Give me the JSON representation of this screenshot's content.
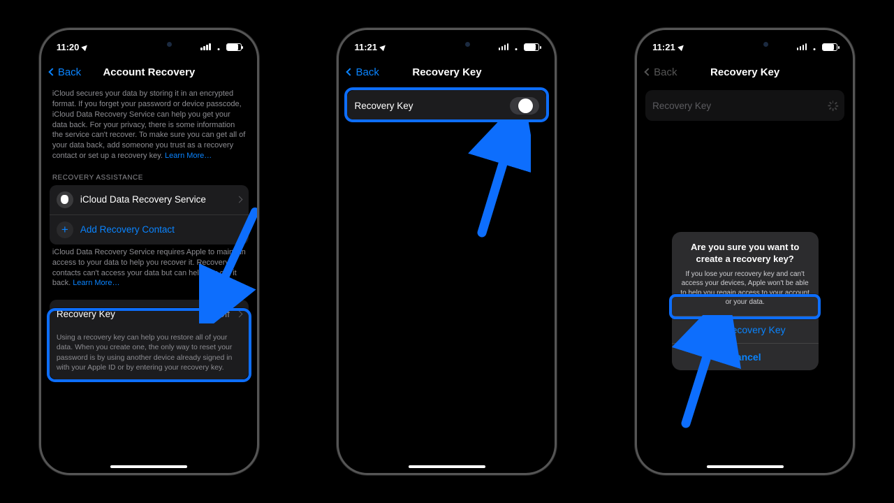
{
  "phone1": {
    "time": "11:20",
    "back": "Back",
    "title": "Account Recovery",
    "intro": "iCloud secures your data by storing it in an encrypted format. If you forget your password or device passcode, iCloud Data Recovery Service can help you get your data back. For your privacy, there is some information the service can't recover. To make sure you can get all of your data back, add someone you trust as a recovery contact or set up a recovery key.",
    "learn_more": "Learn More…",
    "section_label": "RECOVERY ASSISTANCE",
    "row_icloud": "iCloud Data Recovery Service",
    "row_add_contact": "Add Recovery Contact",
    "assist_desc": "iCloud Data Recovery Service requires Apple to maintain access to your data to help you recover it. Recovery contacts can't access your data but can help you get it back.",
    "assist_learn": "Learn More…",
    "recovery_key_label": "Recovery Key",
    "recovery_key_value": "Off",
    "recovery_desc": "Using a recovery key can help you restore all of your data. When you create one, the only way to reset your password is by using another device already signed in with your Apple ID or by entering your recovery key."
  },
  "phone2": {
    "time": "11:21",
    "back": "Back",
    "title": "Recovery Key",
    "toggle_label": "Recovery Key"
  },
  "phone3": {
    "time": "11:21",
    "back": "Back",
    "title": "Recovery Key",
    "row_label": "Recovery Key",
    "dialog_title": "Are you sure you want to create a recovery key?",
    "dialog_body": "If you lose your recovery key and can't access your devices, Apple won't be able to help you regain access to your account or your data.",
    "btn_use": "Use Recovery Key",
    "btn_cancel": "Cancel"
  }
}
